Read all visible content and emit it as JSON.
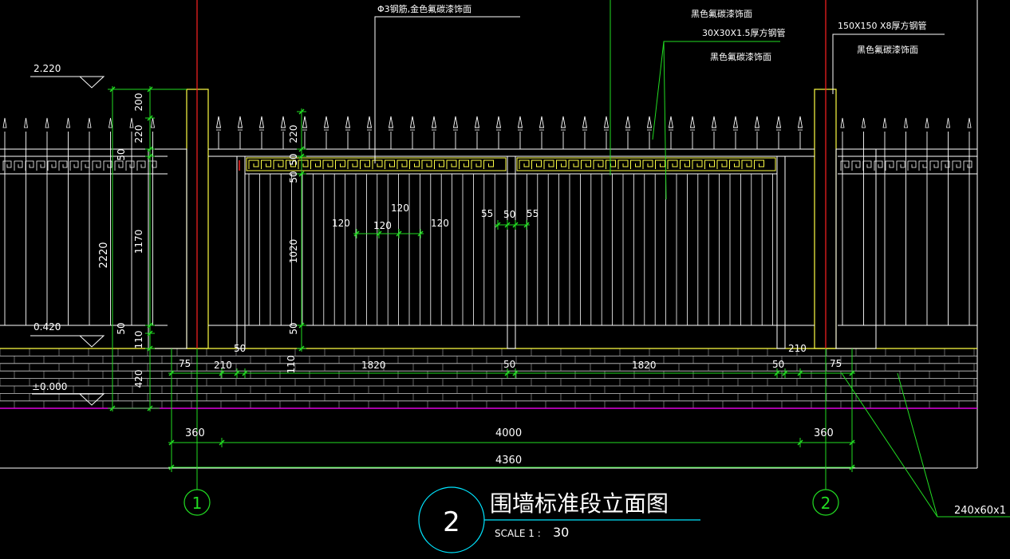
{
  "drawing": {
    "title": "围墙标准段立面图",
    "scale_label": "SCALE 1 :",
    "scale_value": "30",
    "detail_number": "2",
    "axis_left": "1",
    "axis_right": "2"
  },
  "elevations": {
    "top": "2.220",
    "mid": "0.420",
    "ground": "±0.000"
  },
  "annotations": {
    "rod_note": "Φ3钢筋,金色氟碳漆饰面",
    "fluoro_black_1": "黑色氟碳漆饰面",
    "pipe_30": "30X30X1.5厚方钢管",
    "fluoro_black_2": "黑色氟碳漆饰面",
    "pipe_150": "150X150 X8厚方钢管",
    "fluoro_black_3": "黑色氟碳漆饰面",
    "brick": "240x60x1"
  },
  "dims": {
    "left_vertical": [
      "200",
      "220",
      "50",
      "1170",
      "50",
      "110",
      "420"
    ],
    "left_total": "2220",
    "inner_vertical": [
      "220",
      "50",
      "50",
      "1020",
      "50"
    ],
    "pickets": [
      "120",
      "120",
      "120",
      "120"
    ],
    "bar": [
      "55",
      "50",
      "55"
    ],
    "base_row": [
      "75",
      "210",
      "50",
      "110",
      "1820",
      "50",
      "1820",
      "50",
      "210",
      "75"
    ],
    "bottom_row": [
      "360",
      "4000",
      "360"
    ],
    "overall": "4360"
  }
}
